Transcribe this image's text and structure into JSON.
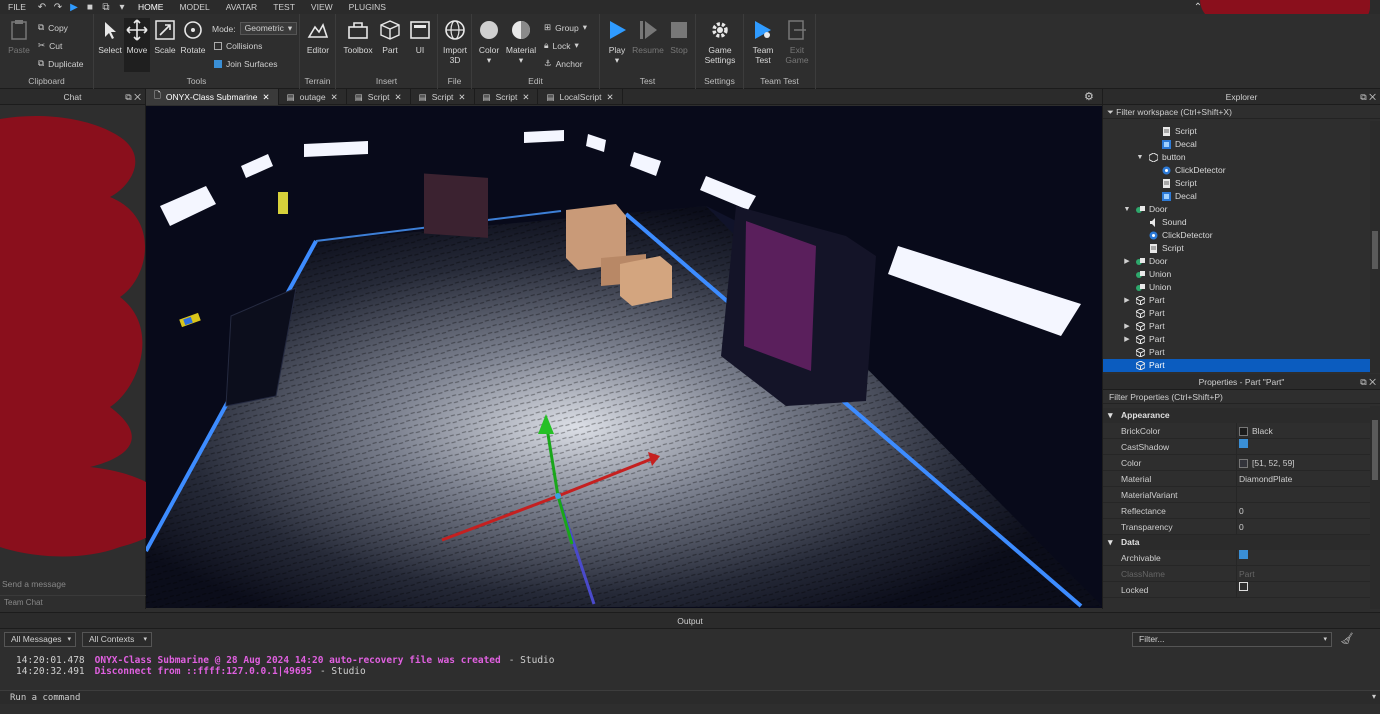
{
  "menu": {
    "items": [
      "FILE",
      "HOME",
      "MODEL",
      "AVATAR",
      "TEST",
      "VIEW",
      "PLUGINS"
    ],
    "active": "HOME"
  },
  "ribbon": {
    "clipboard": {
      "label": "Clipboard",
      "paste": "Paste",
      "copy": "Copy",
      "cut": "Cut",
      "duplicate": "Duplicate"
    },
    "tools": {
      "label": "Tools",
      "select": "Select",
      "move": "Move",
      "scale": "Scale",
      "rotate": "Rotate",
      "mode_label": "Mode:",
      "mode_value": "Geometric",
      "collisions": "Collisions",
      "join_surfaces": "Join Surfaces",
      "collisions_checked": false,
      "join_checked": true
    },
    "terrain": {
      "label": "Terrain",
      "editor": "Editor"
    },
    "insert": {
      "label": "Insert",
      "toolbox": "Toolbox",
      "part": "Part",
      "ui": "UI"
    },
    "file": {
      "label": "File",
      "import3d_line1": "Import",
      "import3d_line2": "3D"
    },
    "edit": {
      "label": "Edit",
      "color": "Color",
      "material": "Material",
      "group": "Group",
      "lock": "Lock",
      "anchor": "Anchor"
    },
    "test": {
      "label": "Test",
      "play": "Play",
      "resume": "Resume",
      "stop": "Stop"
    },
    "settings": {
      "label": "Settings",
      "game_settings_line1": "Game",
      "game_settings_line2": "Settings"
    },
    "team_test": {
      "label": "Team Test",
      "team_line1": "Team",
      "team_line2": "Test",
      "exit_line1": "Exit",
      "exit_line2": "Game"
    }
  },
  "chat": {
    "title": "Chat",
    "placeholder": "Send a message",
    "team_chat": "Team Chat"
  },
  "tabs": [
    {
      "label": "ONYX-Class Submarine",
      "active": true
    },
    {
      "label": "outage"
    },
    {
      "label": "Script"
    },
    {
      "label": "Script"
    },
    {
      "label": "Script"
    },
    {
      "label": "LocalScript"
    }
  ],
  "explorer": {
    "title": "Explorer",
    "filter": "Filter workspace (Ctrl+Shift+X)",
    "rows": [
      {
        "label": "Script",
        "icon": "script",
        "depth": 4
      },
      {
        "label": "Decal",
        "icon": "decal",
        "depth": 4
      },
      {
        "label": "button",
        "icon": "model",
        "depth": 3,
        "expanded": true
      },
      {
        "label": "ClickDetector",
        "icon": "clickdetector",
        "depth": 4
      },
      {
        "label": "Script",
        "icon": "script",
        "depth": 4
      },
      {
        "label": "Decal",
        "icon": "decal",
        "depth": 4
      },
      {
        "label": "Door",
        "icon": "union",
        "depth": 2,
        "expanded": true
      },
      {
        "label": "Sound",
        "icon": "sound",
        "depth": 3
      },
      {
        "label": "ClickDetector",
        "icon": "clickdetector",
        "depth": 3
      },
      {
        "label": "Script",
        "icon": "script",
        "depth": 3
      },
      {
        "label": "Door",
        "icon": "union",
        "depth": 2,
        "collapsed": true
      },
      {
        "label": "Union",
        "icon": "union",
        "depth": 2
      },
      {
        "label": "Union",
        "icon": "union",
        "depth": 2
      },
      {
        "label": "Part",
        "icon": "part",
        "depth": 2,
        "collapsed": true
      },
      {
        "label": "Part",
        "icon": "part",
        "depth": 2
      },
      {
        "label": "Part",
        "icon": "part",
        "depth": 2,
        "collapsed": true
      },
      {
        "label": "Part",
        "icon": "part",
        "depth": 2,
        "collapsed": true
      },
      {
        "label": "Part",
        "icon": "part",
        "depth": 2
      },
      {
        "label": "Part",
        "icon": "part",
        "depth": 2,
        "selected": true
      }
    ]
  },
  "properties": {
    "title": "Properties - Part \"Part\"",
    "filter": "Filter Properties (Ctrl+Shift+P)",
    "sections": [
      {
        "name": "Appearance",
        "props": [
          {
            "name": "BrickColor",
            "value": "Black",
            "swatch": "#1b1b1b"
          },
          {
            "name": "CastShadow",
            "checkbox": true
          },
          {
            "name": "Color",
            "value": "[51, 52, 59]",
            "swatch": "#33343b"
          },
          {
            "name": "Material",
            "value": "DiamondPlate"
          },
          {
            "name": "MaterialVariant",
            "value": ""
          },
          {
            "name": "Reflectance",
            "value": "0"
          },
          {
            "name": "Transparency",
            "value": "0"
          }
        ]
      },
      {
        "name": "Data",
        "props": [
          {
            "name": "Archivable",
            "checkbox": true
          },
          {
            "name": "ClassName",
            "value": "Part",
            "disabled": true
          },
          {
            "name": "Locked",
            "checkbox": false
          }
        ]
      }
    ]
  },
  "output": {
    "title": "Output",
    "messages_filter": "All Messages",
    "contexts_filter": "All Contexts",
    "filter_placeholder": "Filter...",
    "logs": [
      {
        "time": "14:20:01.478",
        "message": "ONYX-Class Submarine @ 28 Aug 2024 14:20 auto-recovery file was created",
        "source": "-  Studio"
      },
      {
        "time": "14:20:32.491",
        "message": "Disconnect from ::ffff:127.0.0.1|49695",
        "source": "-  Studio"
      }
    ],
    "command_placeholder": "Run a command"
  },
  "colors": {
    "accent": "#0b5cbf",
    "play": "#2f9bff",
    "log_message": "#e060e0",
    "panel": "#2e2e2e"
  }
}
